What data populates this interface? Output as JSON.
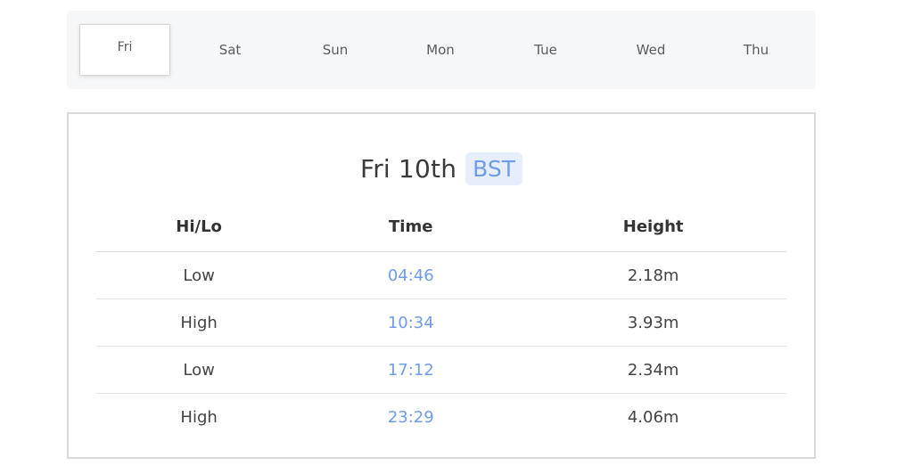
{
  "day_tabs": [
    {
      "label": "Fri",
      "active": true
    },
    {
      "label": "Sat",
      "active": false
    },
    {
      "label": "Sun",
      "active": false
    },
    {
      "label": "Mon",
      "active": false
    },
    {
      "label": "Tue",
      "active": false
    },
    {
      "label": "Wed",
      "active": false
    },
    {
      "label": "Thu",
      "active": false
    }
  ],
  "card": {
    "date_title": "Fri 10th",
    "timezone": "BST",
    "headers": {
      "hilo": "Hi/Lo",
      "time": "Time",
      "height": "Height"
    },
    "rows": [
      {
        "hilo": "Low",
        "time": "04:46",
        "height": "2.18m"
      },
      {
        "hilo": "High",
        "time": "10:34",
        "height": "3.93m"
      },
      {
        "hilo": "Low",
        "time": "17:12",
        "height": "2.34m"
      },
      {
        "hilo": "High",
        "time": "23:29",
        "height": "4.06m"
      }
    ]
  },
  "colors": {
    "accent_blue": "#6f9ce8",
    "badge_bg": "#e6eefb",
    "tabs_bg": "#f6f7f9"
  }
}
